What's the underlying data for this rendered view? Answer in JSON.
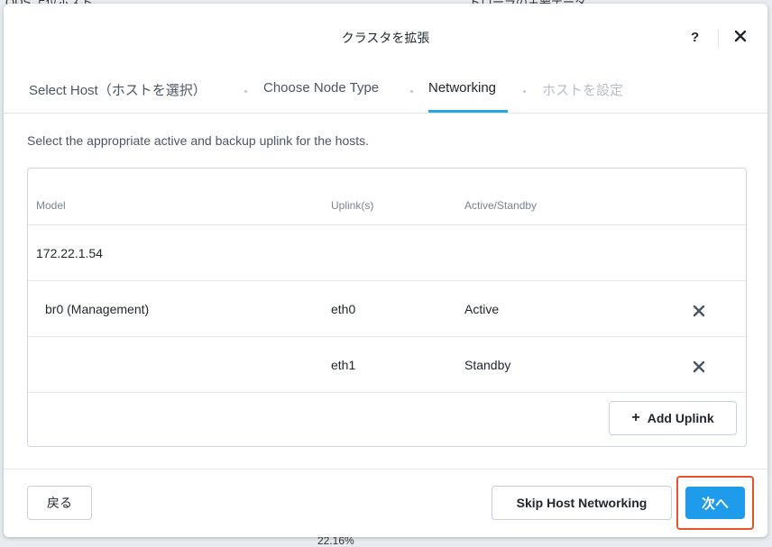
{
  "background": {
    "fragment_1": "ODS 上位ホスト",
    "fragment_2": "ドローラの主要データ",
    "fragment_3": "22.16%"
  },
  "dialog": {
    "title": "クラスタを拡張",
    "help_label": "?"
  },
  "tabs": [
    {
      "label": "Select Host（ホストを選択）",
      "state": "done"
    },
    {
      "label": "Choose Node Type",
      "state": "done"
    },
    {
      "label": "Networking",
      "state": "active"
    },
    {
      "label": "ホストを設定",
      "state": "disabled"
    }
  ],
  "description": "Select the appropriate active and backup uplink for the hosts.",
  "table": {
    "headers": [
      "Model",
      "Uplink(s)",
      "Active/Standby"
    ],
    "host": "172.22.1.54",
    "rows": [
      {
        "model": "br0 (Management)",
        "uplink": "eth0",
        "mode": "Active"
      },
      {
        "model": "",
        "uplink": "eth1",
        "mode": "Standby"
      }
    ],
    "add_uplink_label": "Add Uplink"
  },
  "footer": {
    "back_label": "戻る",
    "skip_label": "Skip Host Networking",
    "next_label": "次へ"
  },
  "colors": {
    "accent": "#2aa2e8",
    "primary_button": "#1e9bea",
    "highlight_border": "#e8532b"
  }
}
